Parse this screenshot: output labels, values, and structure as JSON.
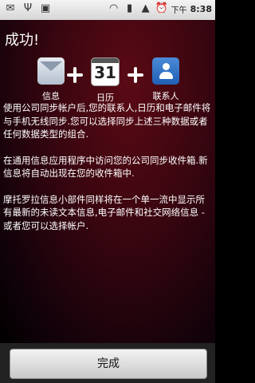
{
  "status_bar": {
    "time": "8:38",
    "ampm": "下午",
    "icons_left": [
      "mail-icon",
      "usb-icon",
      "android-icon"
    ],
    "icons_right": [
      "wifi-icon",
      "battery-charging-icon",
      "signal-icon",
      "alarm-icon"
    ]
  },
  "title": "成功!",
  "apps": [
    {
      "label": "信息",
      "icon": "envelope-icon"
    },
    {
      "label": "日历",
      "icon": "calendar-icon",
      "day": "31"
    },
    {
      "label": "联系人",
      "icon": "contacts-icon"
    }
  ],
  "paragraphs": [
    "使用公司同步帐户后,您的联系人,日历和电子邮件将与手机无线同步.您可以选择同步上述三种数据或者任何数据类型的组合.",
    "在通用信息应用程序中访问您的公司同步收件箱.新信息将自动出现在您的收件箱中.",
    "摩托罗拉信息小部件同样将在一个单一流中显示所有最新的未读文本信息,电子邮件和社交网络信息 - 或者您可以选择帐户."
  ],
  "done_button": "完成"
}
